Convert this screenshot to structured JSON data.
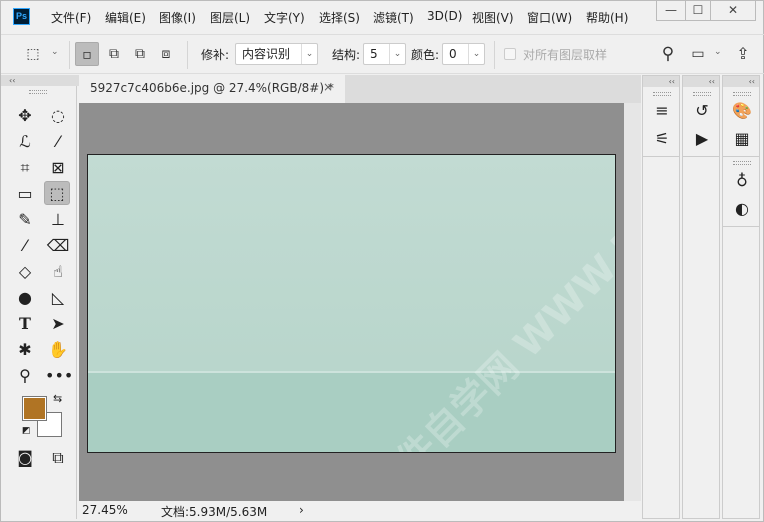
{
  "app": {
    "logo": "Ps"
  },
  "menu": [
    "文件(F)",
    "编辑(E)",
    "图像(I)",
    "图层(L)",
    "文字(Y)",
    "选择(S)",
    "滤镜(T)",
    "3D(D)",
    "视图(V)",
    "窗口(W)",
    "帮助(H)"
  ],
  "window_controls": {
    "minimize": "—",
    "maximize": "☐",
    "close": "✕"
  },
  "options": {
    "patch_label": "修补:",
    "patch_value": "内容识别",
    "structure_label": "结构:",
    "structure_value": "5",
    "color_label": "颜色:",
    "color_value": "0",
    "sample_all_label": "对所有图层取样",
    "sample_all_checked": false
  },
  "document": {
    "tab_title": "5927c7c406b6e.jpg @ 27.4%(RGB/8#) *",
    "close": "×",
    "watermark": "软件自学网 WWW.RJZXW.COM"
  },
  "status": {
    "zoom": "27.45%",
    "doc_info": "文档:5.93M/5.63M",
    "arrow": "›"
  },
  "colors": {
    "foreground": "#b07424",
    "background": "#ffffff"
  }
}
